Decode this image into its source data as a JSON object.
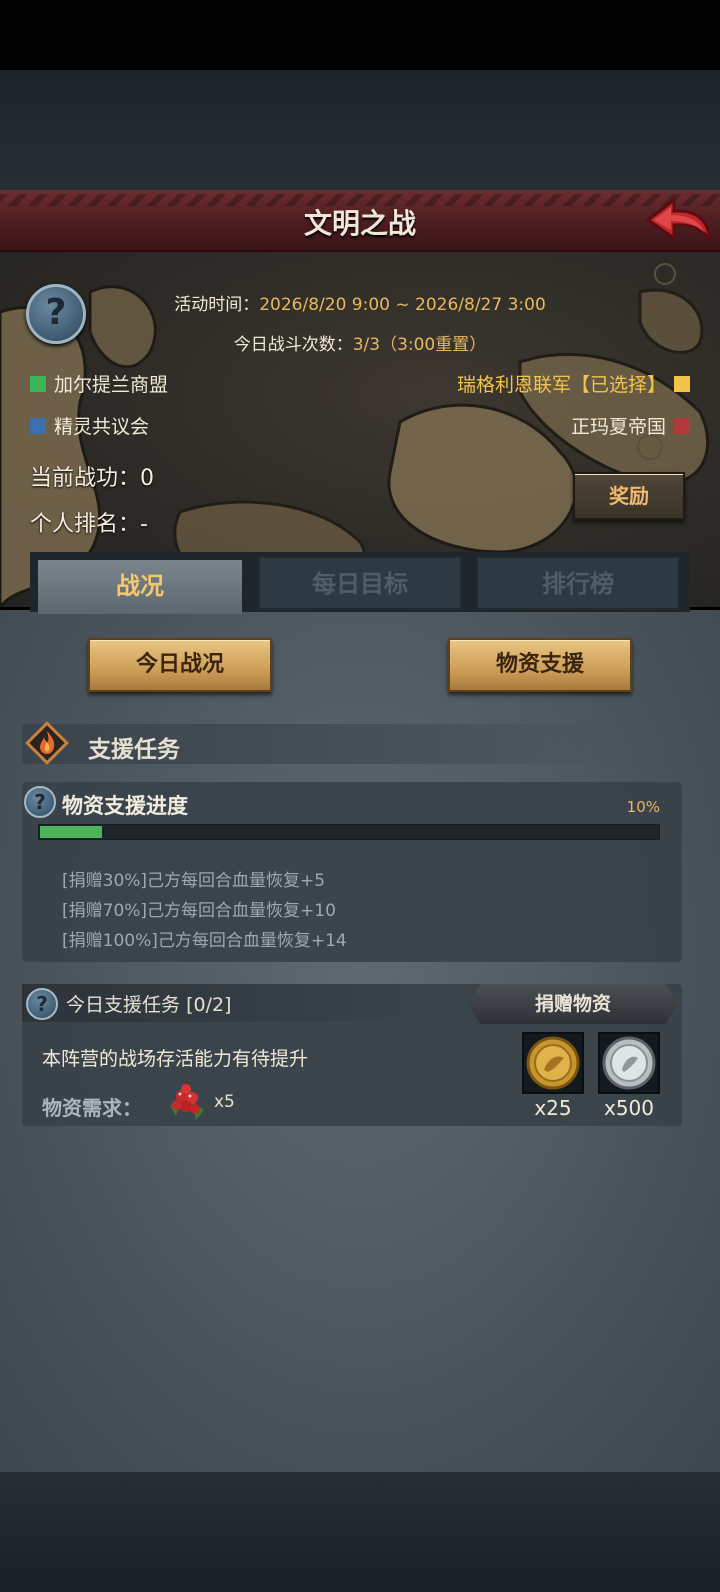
{
  "title": "文明之战",
  "event": {
    "time_label": "活动时间：",
    "time_value": "2026/8/20 9:00 ~ 2026/8/27 3:00",
    "count_label": "今日战斗次数：",
    "count_value": "3/3（3:00重置）"
  },
  "factions": {
    "left": [
      {
        "name": "加尔提兰商盟",
        "color": "#3fb35a"
      },
      {
        "name": "精灵共议会",
        "color": "#3b6fb0"
      }
    ],
    "right": [
      {
        "name": "瑞格利恩联军【已选择】",
        "color": "#f3c44c"
      },
      {
        "name": "正玛夏帝国",
        "color": "#b33a3a"
      }
    ]
  },
  "stats": {
    "merit": "当前战功：0",
    "rank": "个人排名：-"
  },
  "reward_button": "奖励",
  "tabs": [
    {
      "label": "战况",
      "active": true
    },
    {
      "label": "每日目标",
      "active": false
    },
    {
      "label": "排行榜",
      "active": false
    }
  ],
  "sub_buttons": {
    "today": "今日战况",
    "support": "物资支援"
  },
  "section": {
    "title": "支援任务"
  },
  "progress": {
    "title": "物资支援进度",
    "percent_text": "10%",
    "fraction": 0.1,
    "bonuses": [
      "[捐赠30%]己方每回合血量恢复+5",
      "[捐赠70%]己方每回合血量恢复+10",
      "[捐赠100%]己方每回合血量恢复+14"
    ]
  },
  "daily_task": {
    "title": "今日支援任务",
    "count": "[0/2]",
    "donate_button": "捐赠物资",
    "description": "本阵营的战场存活能力有待提升",
    "need_label": "物资需求：",
    "need_icon": "berry-icon",
    "need_qty": "x5",
    "rewards": [
      {
        "icon": "gold-coin-icon",
        "qty": "x25"
      },
      {
        "icon": "silver-coin-icon",
        "qty": "x500"
      }
    ]
  }
}
